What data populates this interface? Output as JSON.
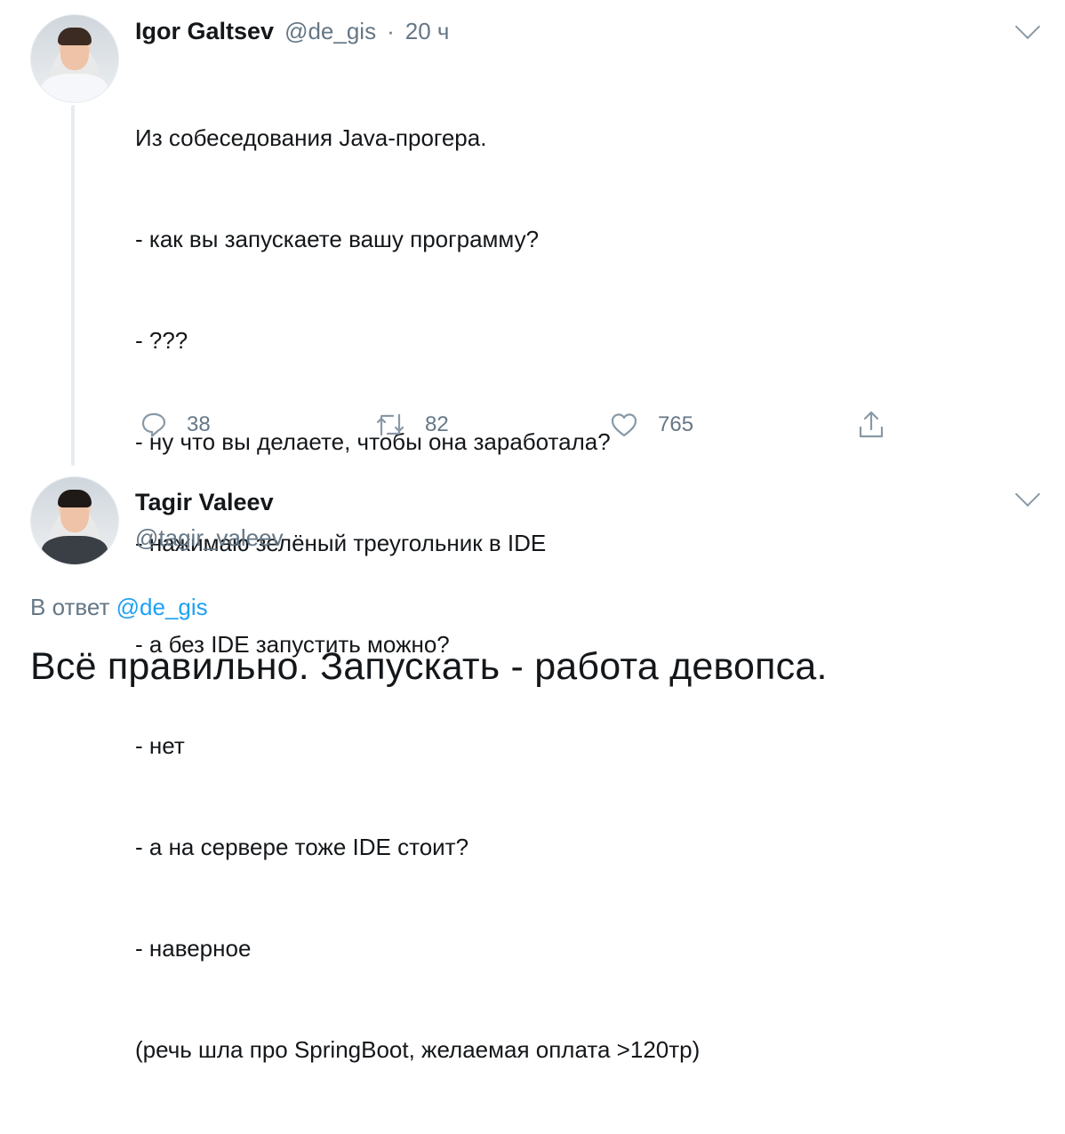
{
  "tweet": {
    "author_name": "Igor Galtsev",
    "author_handle": "@de_gis",
    "dot": "·",
    "time": "20 ч",
    "lines": [
      "Из собеседования Java-прогера.",
      "- как вы запускаете вашу программу?",
      "- ???",
      "- ну что вы делаете, чтобы она заработала?",
      "- нажимаю зелёный треугольник в IDE",
      "- а без IDE запустить можно?",
      "- нет",
      "- а на сервере тоже IDE стоит?",
      "- наверное",
      "(речь шла про SpringBoot, желаемая оплата >120тр)"
    ],
    "reply_count": "38",
    "retweet_count": "82",
    "like_count": "765"
  },
  "reply": {
    "author_name": "Tagir Valeev",
    "author_handle": "@tagir_valeev",
    "reply_prefix": "В ответ",
    "reply_to_handle": "@de_gis",
    "text": "Всё правильно. Запускать - работа девопса."
  },
  "icons": {
    "reply": "reply-icon",
    "retweet": "retweet-icon",
    "like": "heart-icon",
    "share": "share-icon",
    "menu": "chevron-down-icon"
  },
  "colors": {
    "text": "#14171a",
    "secondary": "#657786",
    "link": "#1da1f2",
    "thread_line": "#e6ecf0"
  }
}
